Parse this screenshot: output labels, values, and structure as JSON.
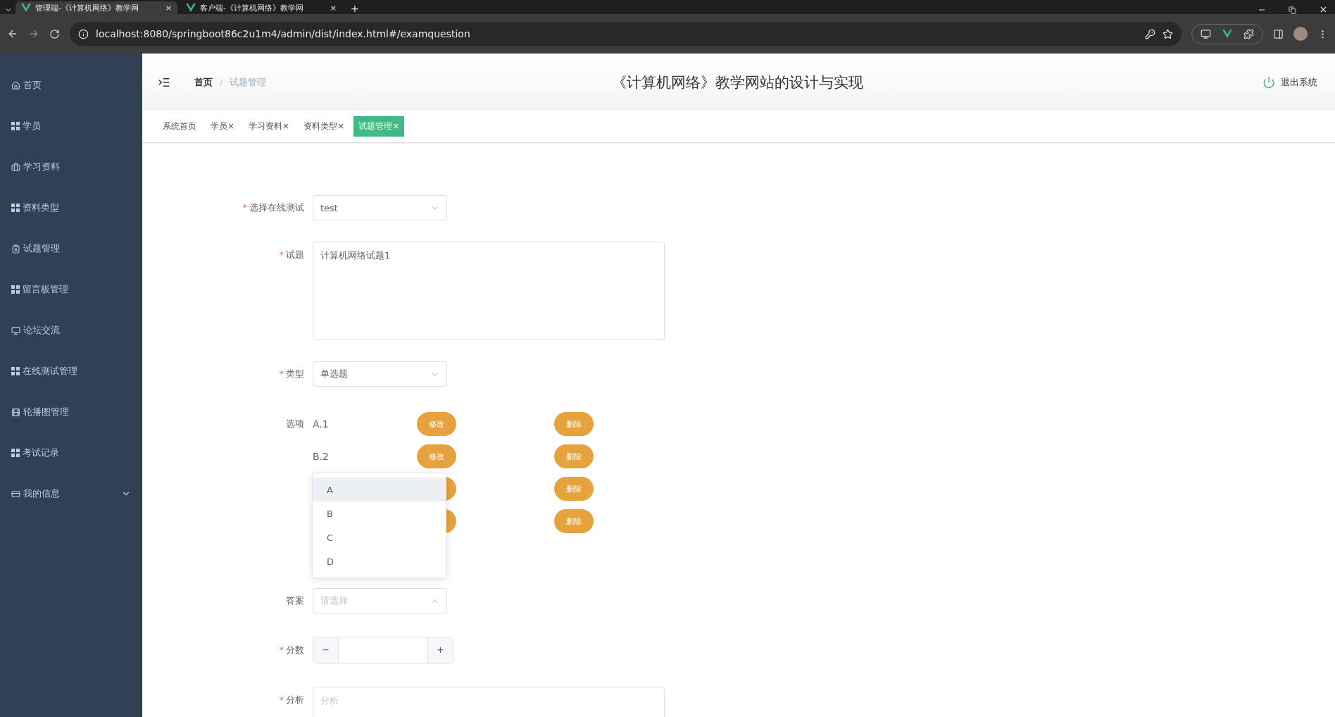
{
  "browser": {
    "tabs": [
      {
        "title": "管理端-《计算机网络》教学网",
        "selected": true,
        "close": "×"
      },
      {
        "title": "客户端-《计算机网络》教学网",
        "selected": false,
        "close": "×"
      }
    ],
    "new_tab": "+",
    "url": "localhost:8080/springboot86c2u1m4/admin/dist/index.html#/examquestion"
  },
  "sidebar": {
    "items": [
      {
        "label": "首页",
        "kind": "link"
      },
      {
        "label": "学员",
        "kind": "link"
      },
      {
        "label": "学习资料",
        "kind": "link"
      },
      {
        "label": "资料类型",
        "kind": "link"
      },
      {
        "label": "试题管理",
        "kind": "link"
      },
      {
        "label": "留言板管理",
        "kind": "link"
      },
      {
        "label": "论坛交流",
        "kind": "link"
      },
      {
        "label": "在线测试管理",
        "kind": "link"
      },
      {
        "label": "轮播图管理",
        "kind": "link"
      },
      {
        "label": "考试记录",
        "kind": "link"
      },
      {
        "label": "我的信息",
        "kind": "submenu"
      }
    ]
  },
  "header": {
    "breadcrumb": [
      "首页",
      "试题管理"
    ],
    "separator": "/",
    "title": "《计算机网络》教学网站的设计与实现",
    "logout": "退出系统"
  },
  "page_tabs": [
    {
      "label": "系统首页",
      "selected": false
    },
    {
      "label": "学员",
      "selected": false,
      "close": "×"
    },
    {
      "label": "学习资料",
      "selected": false,
      "close": "×"
    },
    {
      "label": "资料类型",
      "selected": false,
      "close": "×"
    },
    {
      "label": "试题管理",
      "selected": true,
      "close": "×"
    }
  ],
  "form": {
    "exam": {
      "label": "选择在线测试",
      "mark": "*",
      "value": "test"
    },
    "question": {
      "label": "试题",
      "mark": "*",
      "value": "计算机网络试题1"
    },
    "type": {
      "label": "类型",
      "mark": "*",
      "value": "单选题"
    },
    "options": {
      "label": "选项",
      "rows": [
        {
          "text": "A.1",
          "edit": "修改",
          "delete": "删除"
        },
        {
          "text": "B.2",
          "edit": "修改",
          "delete": "删除"
        },
        {
          "delete": "删除"
        },
        {
          "delete": "删除"
        }
      ]
    },
    "answer": {
      "label": "答案",
      "placeholder": "请选择",
      "expanded": true,
      "choices": [
        {
          "label": "A",
          "highlighted": true
        },
        {
          "label": "B",
          "highlighted": false
        },
        {
          "label": "C",
          "highlighted": false
        },
        {
          "label": "D",
          "highlighted": false
        }
      ]
    },
    "score": {
      "label": "分数",
      "mark": "*",
      "decrement": "−",
      "increment": "+"
    },
    "analysis": {
      "label": "分析",
      "mark": "*",
      "placeholder": "分析"
    }
  }
}
